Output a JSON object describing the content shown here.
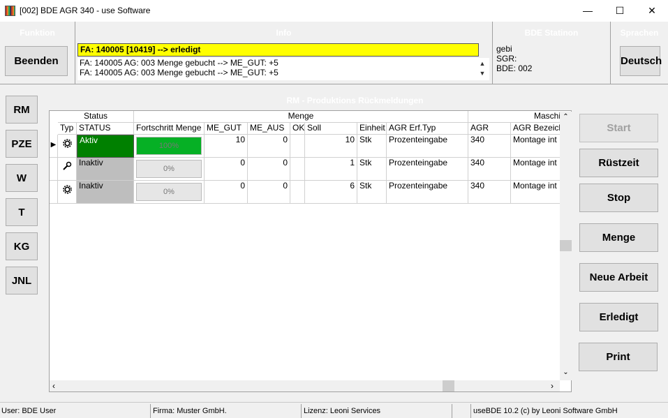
{
  "window": {
    "title": "[002] BDE AGR 340 - use Software",
    "min": "—",
    "max": "☐",
    "close": "✕"
  },
  "panels": {
    "funktion": "Funktion",
    "info": "Info",
    "station": "BDE Statinon",
    "sprachen": "Sprachen"
  },
  "buttons": {
    "beenden": "Beenden",
    "deutsch": "Deutsch"
  },
  "info": {
    "highlight": "FA: 140005 [10419] --> erledigt",
    "lines": [
      "FA: 140005 AG: 003 Menge gebucht --> ME_GUT: +5",
      "FA: 140005 AG: 003 Menge gebucht --> ME_GUT: +5"
    ]
  },
  "station": {
    "user": "gebi",
    "sgr": "SGR:",
    "bde": "BDE: 002"
  },
  "section_title": "RM - Produktions Rückmeldungen",
  "nav": [
    "RM",
    "PZE",
    "W",
    "T",
    "KG",
    "JNL"
  ],
  "grid": {
    "group_headers": {
      "status": "Status",
      "menge": "Menge",
      "maschine": "Maschi"
    },
    "columns": [
      "Typ",
      "STATUS",
      "Fortschritt Menge",
      "ME_GUT",
      "ME_AUS",
      "OK",
      "Soll",
      "Einheit",
      "AGR Erf.Typ",
      "AGR",
      "AGR Bezeich"
    ],
    "rows": [
      {
        "icon": "gear-icon",
        "status": "Aktiv",
        "status_color": "#008000",
        "progress_text": "100%",
        "progress": 1.0,
        "me_gut": "10",
        "me_aus": "0",
        "ok": "",
        "soll": "10",
        "einheit": "Stk",
        "erf_typ": "Prozenteingabe",
        "agr": "340",
        "bezeich": "Montage int"
      },
      {
        "icon": "wrench-icon",
        "status": "Inaktiv",
        "status_color": "#bebebe",
        "progress_text": "0%",
        "progress": 0.0,
        "me_gut": "0",
        "me_aus": "0",
        "ok": "",
        "soll": "1",
        "einheit": "Stk",
        "erf_typ": "Prozenteingabe",
        "agr": "340",
        "bezeich": "Montage int"
      },
      {
        "icon": "gear-icon",
        "status": "Inaktiv",
        "status_color": "#bebebe",
        "progress_text": "0%",
        "progress": 0.0,
        "me_gut": "0",
        "me_aus": "0",
        "ok": "",
        "soll": "6",
        "einheit": "Stk",
        "erf_typ": "Prozenteingabe",
        "agr": "340",
        "bezeich": "Montage int"
      }
    ]
  },
  "actions": [
    {
      "label": "Start",
      "enabled": false
    },
    {
      "label": "Rüstzeit",
      "enabled": true
    },
    {
      "label": "Stop",
      "enabled": true
    },
    {
      "label": "Menge",
      "enabled": true
    },
    {
      "label": "Neue Arbeit",
      "enabled": true
    },
    {
      "label": "Erledigt",
      "enabled": true
    },
    {
      "label": "Print",
      "enabled": true
    }
  ],
  "statusbar": {
    "user": "User: BDE User",
    "firma": "Firma: Muster GmbH.",
    "lizenz": "Lizenz: Leoni Services",
    "empty": "",
    "version": "useBDE 10.2 (c) by Leoni Software GmbH"
  }
}
